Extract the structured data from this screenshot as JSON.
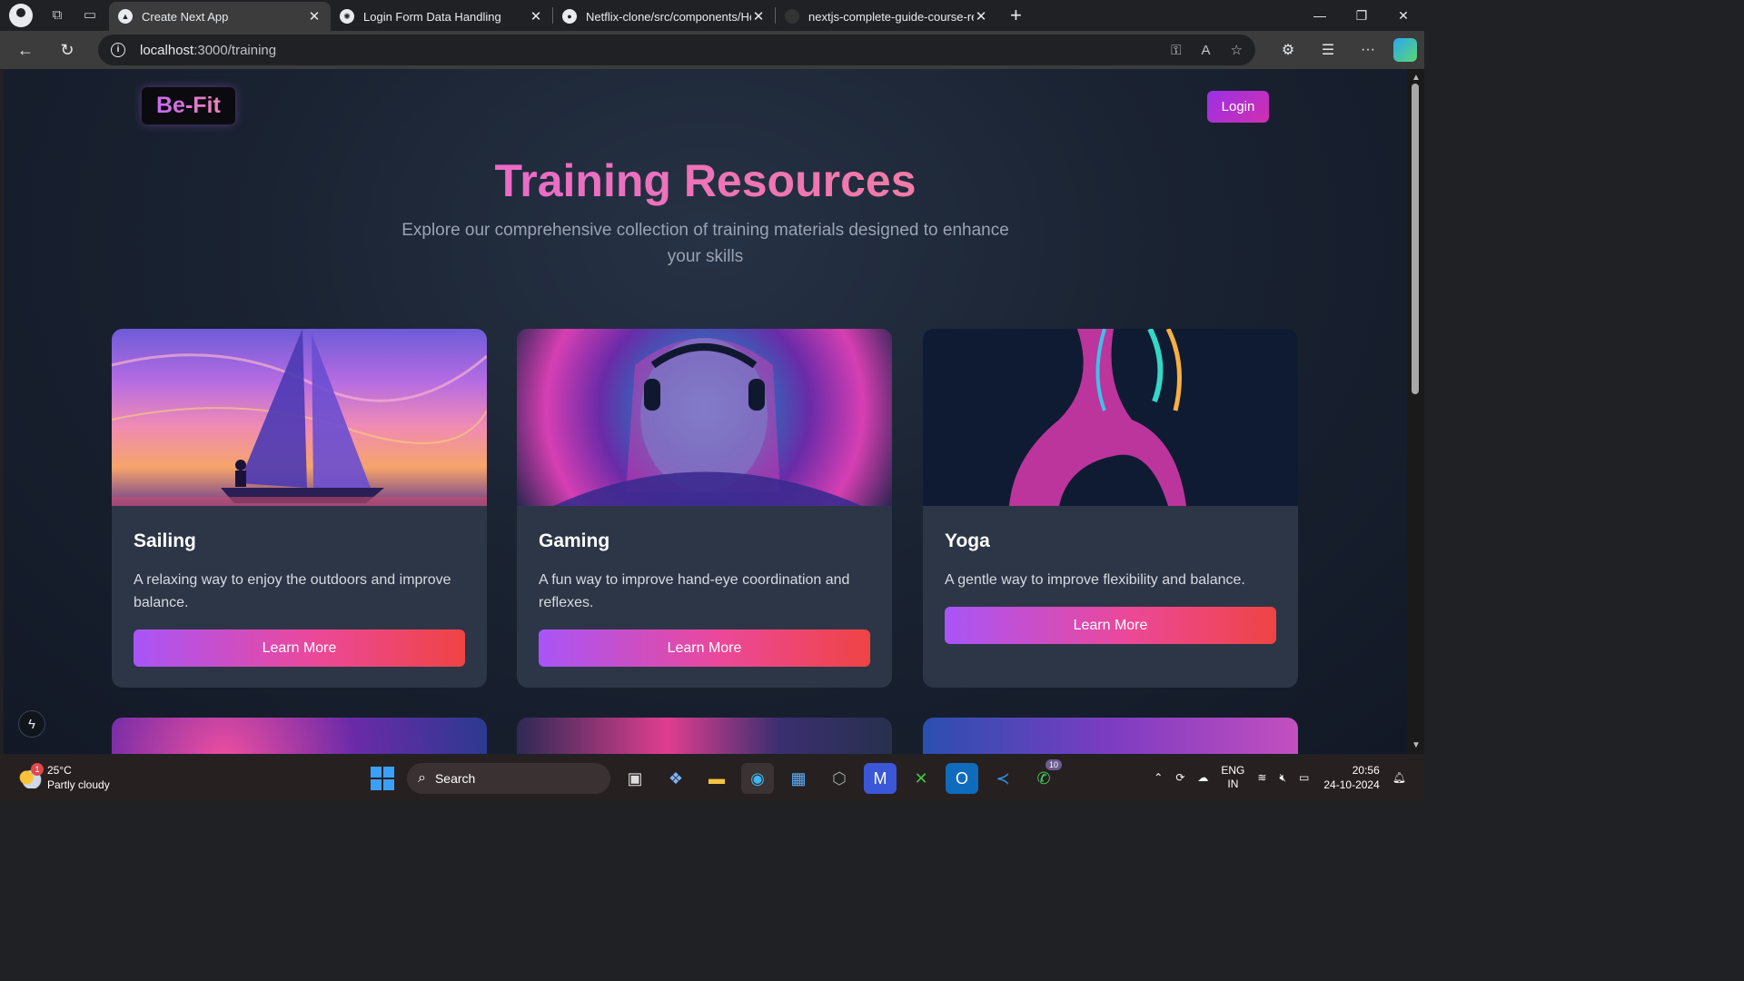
{
  "browser": {
    "tabs": [
      {
        "title": "Create Next App",
        "active": true
      },
      {
        "title": "Login Form Data Handling",
        "active": false
      },
      {
        "title": "Netflix-clone/src/components/Hea",
        "active": false
      },
      {
        "title": "nextjs-complete-guide-course-res",
        "active": false
      }
    ],
    "url_host": "localhost",
    "url_path": ":3000/training"
  },
  "site": {
    "logo": "Be-Fit",
    "login_label": "Login",
    "hero_title": "Training Resources",
    "hero_subtitle": "Explore our comprehensive collection of training materials designed to enhance your skills"
  },
  "cards": [
    {
      "title": "Sailing",
      "description": "A relaxing way to enjoy the outdoors and improve balance.",
      "button": "Learn More"
    },
    {
      "title": "Gaming",
      "description": "A fun way to improve hand-eye coordination and reflexes.",
      "button": "Learn More"
    },
    {
      "title": "Yoga",
      "description": "A gentle way to improve flexibility and balance.",
      "button": "Learn More"
    }
  ],
  "taskbar": {
    "temperature": "25°C",
    "weather": "Partly cloudy",
    "weather_badge": "1",
    "search_label": "Search",
    "whatsapp_badge": "10",
    "lang_top": "ENG",
    "lang_bottom": "IN",
    "time": "20:56",
    "date": "24-10-2024"
  },
  "colors": {
    "accent_pink": "#ec4899",
    "accent_purple": "#a855f7",
    "button_red": "#ef4444",
    "card_bg": "#2d3646"
  }
}
